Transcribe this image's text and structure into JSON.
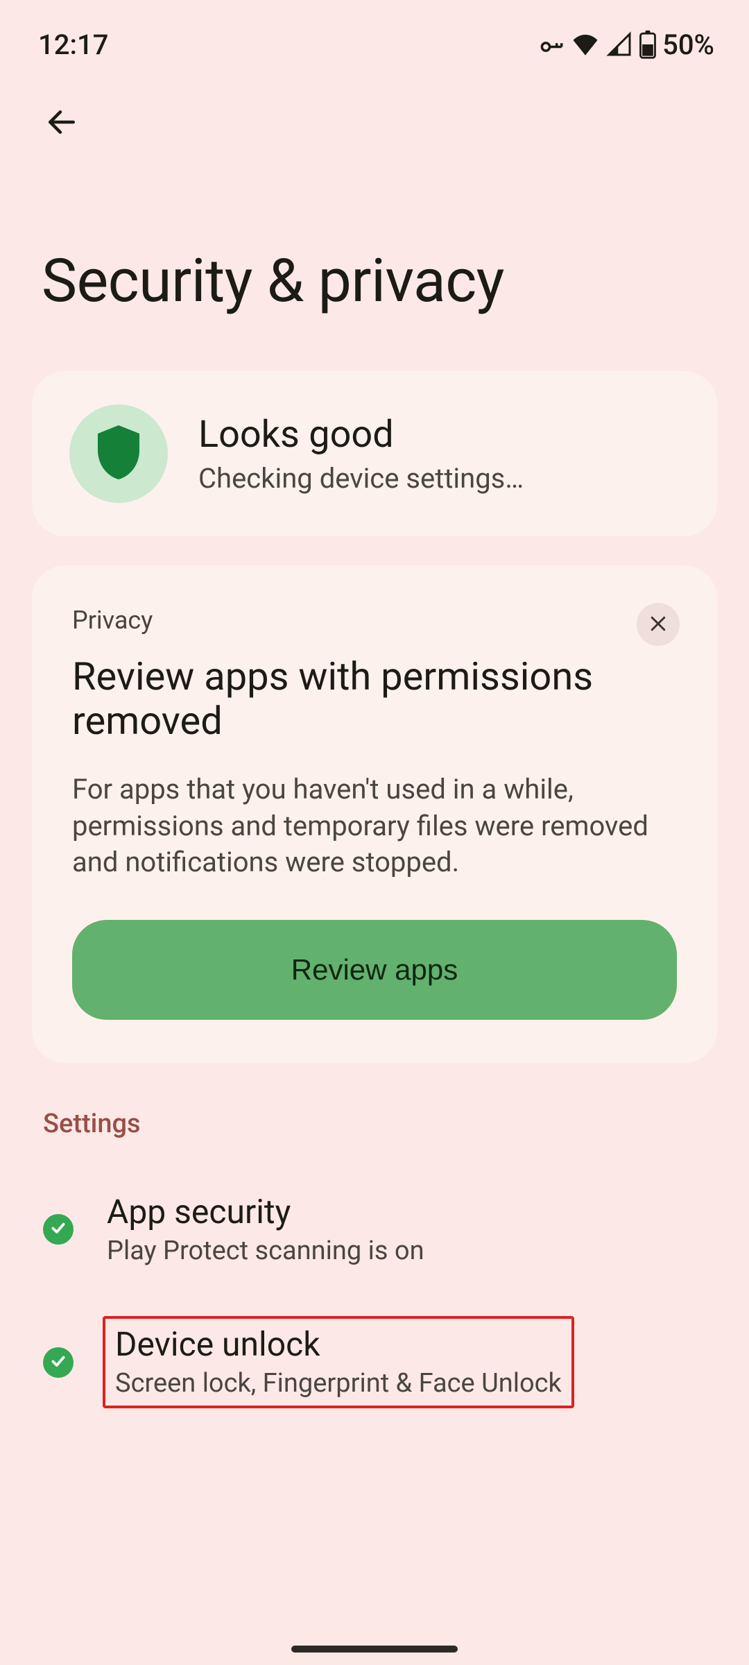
{
  "status_bar": {
    "time": "12:17",
    "battery_text": "50%"
  },
  "page": {
    "title": "Security & privacy"
  },
  "status_card": {
    "title": "Looks good",
    "subtitle": "Checking device settings…"
  },
  "privacy_card": {
    "tag": "Privacy",
    "title": "Review apps with permissions removed",
    "description": "For apps that you haven't used in a while, permissions and temporary files were removed and notifications were stopped.",
    "button_label": "Review apps"
  },
  "settings": {
    "header": "Settings",
    "items": [
      {
        "title": "App security",
        "subtitle": "Play Protect scanning is on"
      },
      {
        "title": "Device unlock",
        "subtitle": "Screen lock, Fingerprint & Face Unlock"
      }
    ]
  }
}
